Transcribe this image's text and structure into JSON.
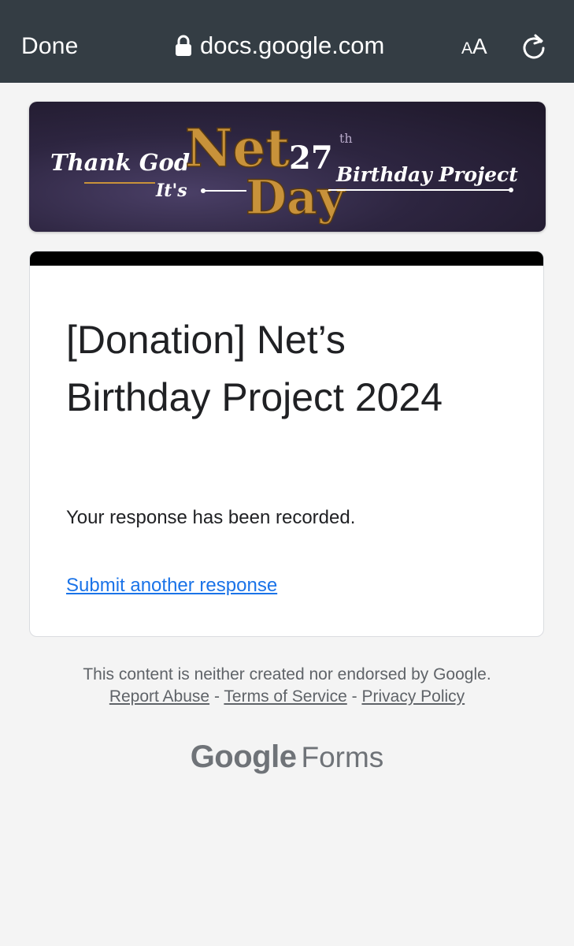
{
  "browser": {
    "done_label": "Done",
    "url": "docs.google.com",
    "text_size_small": "A",
    "text_size_large": "A",
    "icons": [
      "lock-icon",
      "reload-icon"
    ]
  },
  "banner": {
    "line_left_1": "Thank God",
    "line_left_2": "It's",
    "big_word_1": "Net",
    "big_word_2": "Day",
    "number": "27",
    "suffix": "th",
    "line_right": "Birthday Project",
    "colors": {
      "gold": "#c8923a",
      "background": "#2d2540"
    }
  },
  "form": {
    "title": "[Donation] Net’s Birthday Project 2024",
    "message": "Your response has been recorded.",
    "submit_another": "Submit another response",
    "accent_color": "#000000",
    "link_color": "#1a73e8"
  },
  "footer": {
    "disclaimer": "This content is neither created nor endorsed by Google.",
    "report_abuse": "Report Abuse",
    "terms": "Terms of Service",
    "privacy": "Privacy Policy",
    "separator": "-",
    "logo_google": "Google",
    "logo_forms": "Forms"
  }
}
